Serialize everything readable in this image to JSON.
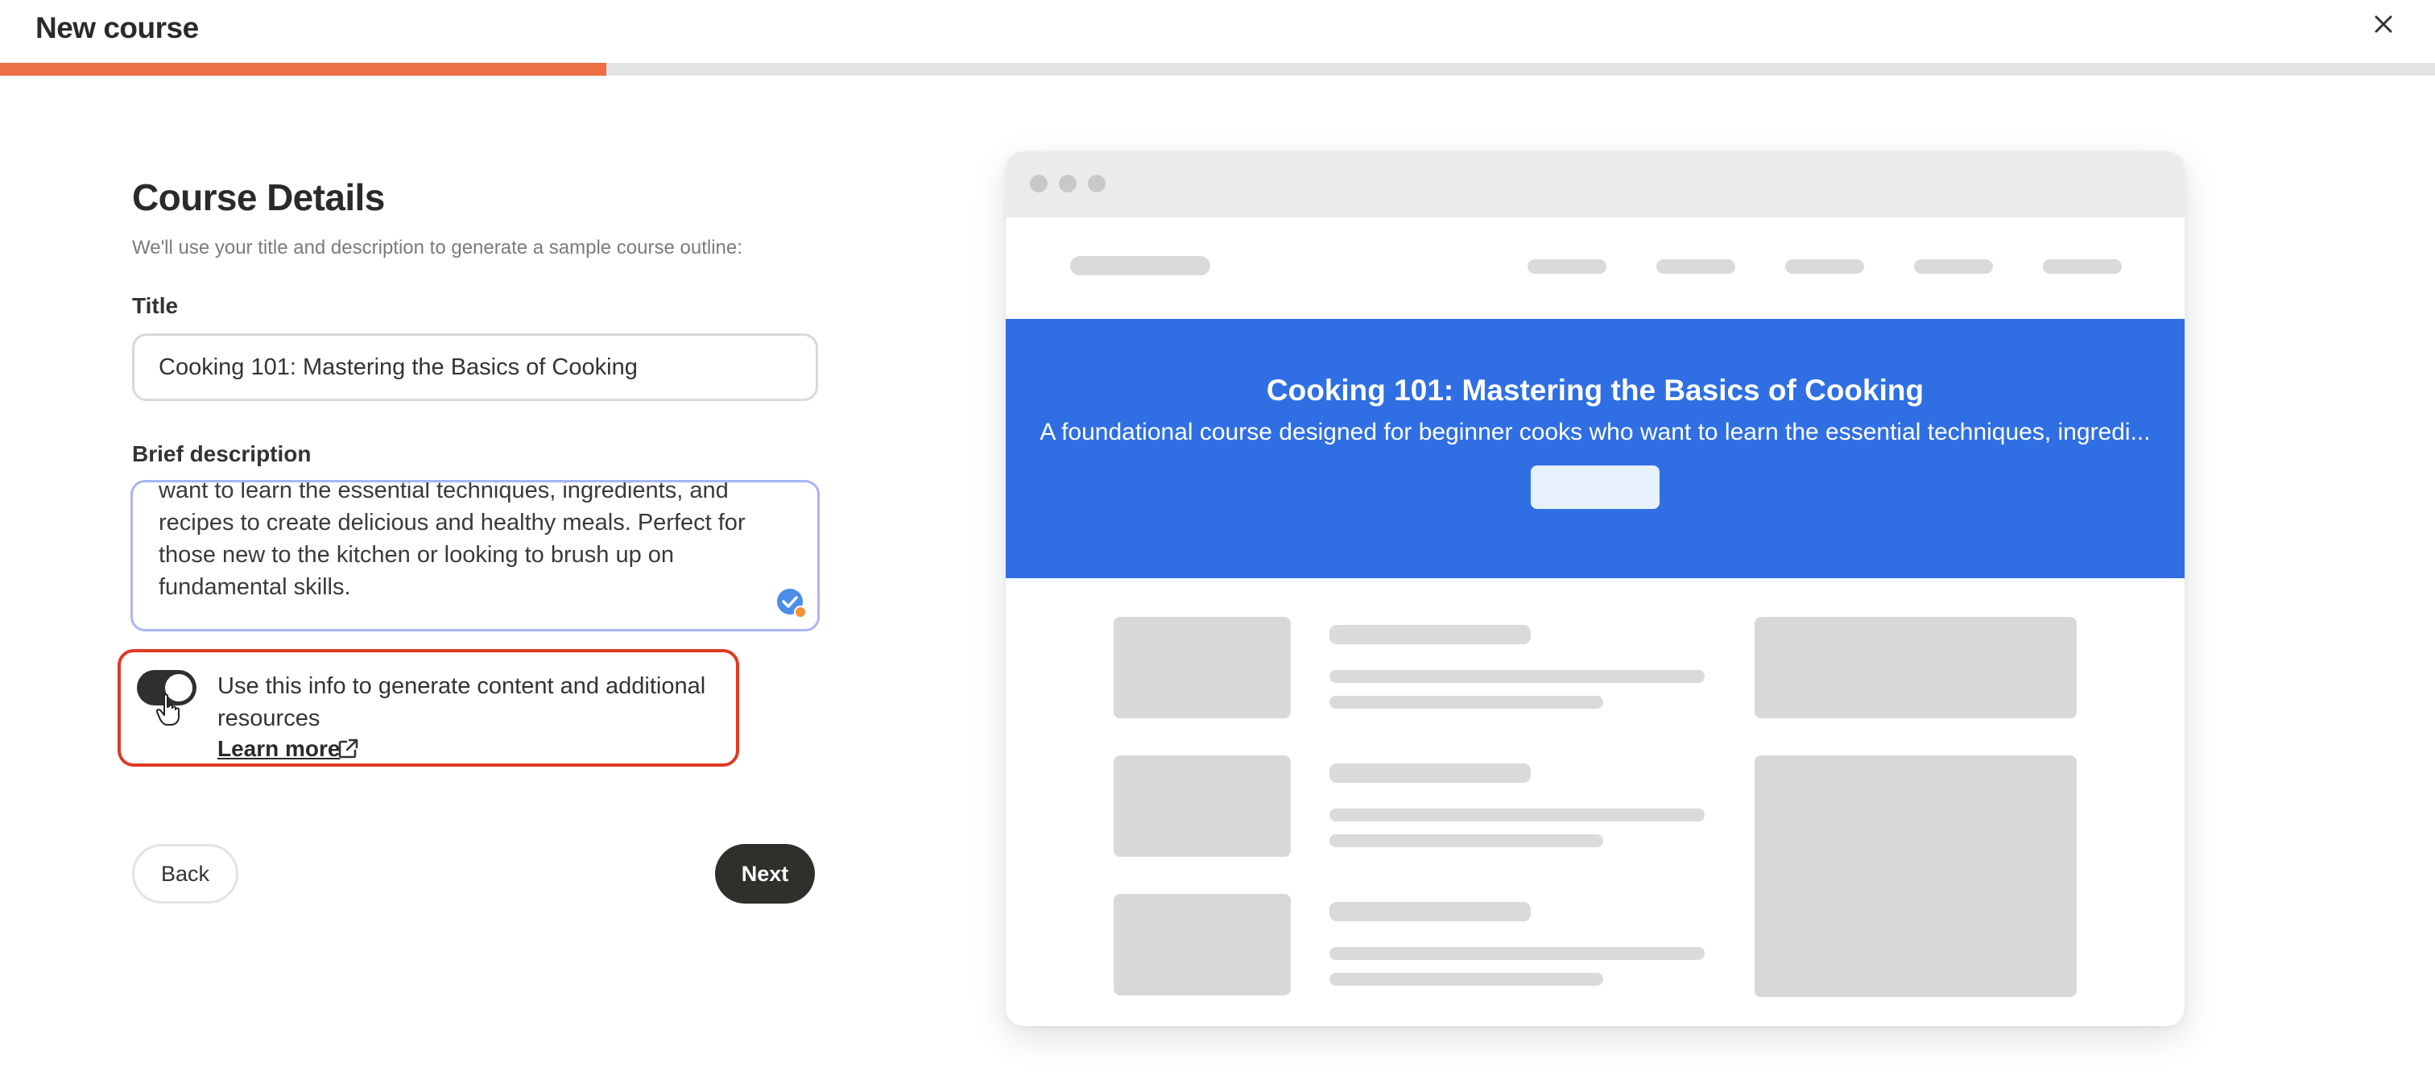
{
  "header": {
    "title": "New course",
    "progress_fraction": 0.249
  },
  "form": {
    "heading": "Course Details",
    "subheading": "We'll use your title and description to generate a sample course outline:",
    "title_label": "Title",
    "title_value": "Cooking 101: Mastering the Basics of Cooking",
    "description_label": "Brief description",
    "description_value": "want to learn the essential techniques, ingredients, and recipes to create delicious and healthy meals. Perfect for those new to the kitchen or looking to brush up on fundamental skills.",
    "toggle_on": true,
    "toggle_label": "Use this info to generate content and additional resources",
    "learn_more": "Learn more",
    "back_label": "Back",
    "next_label": "Next"
  },
  "preview": {
    "hero_title": "Cooking 101: Mastering the Basics of Cooking",
    "hero_subtitle": "A foundational course designed for beginner cooks who want to learn the essential techniques, ingredi..."
  },
  "colors": {
    "accent": "#ec6f45",
    "hero": "#2f6fe3",
    "highlight": "#e03a24",
    "dark_button": "#2f2f2c"
  },
  "icons": {
    "close": "close-icon",
    "external": "external-link-icon",
    "grammar": "grammar-check-icon",
    "cursor": "hand-pointer-icon"
  }
}
